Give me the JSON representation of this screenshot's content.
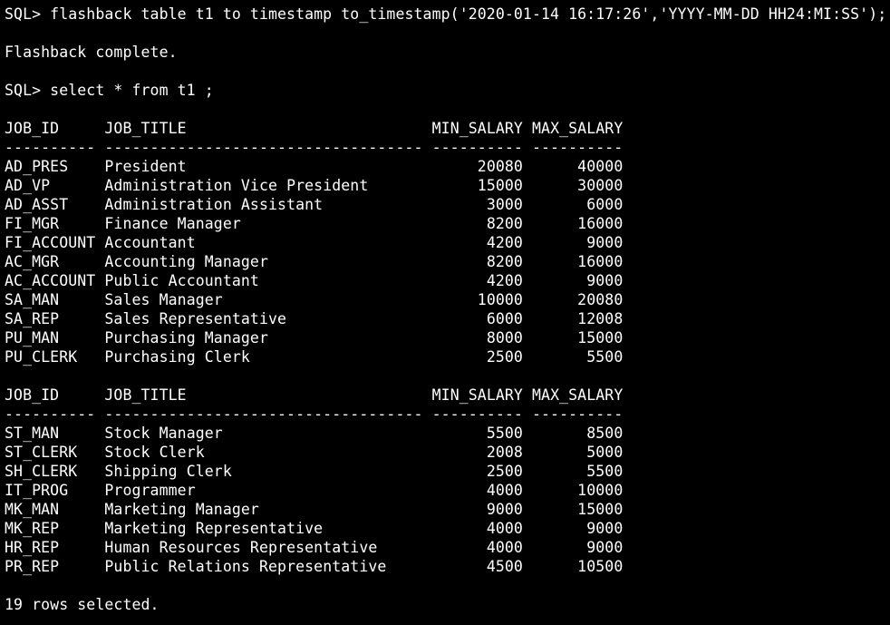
{
  "terminal": {
    "prompt": "SQL> ",
    "command_flashback": "flashback table t1 to timestamp to_timestamp('2020-01-14 16:17:26','YYYY-MM-DD HH24:MI:SS');",
    "flashback_result": "Flashback complete.",
    "command_select": "select * from t1 ;",
    "columns": {
      "job_id": "JOB_ID",
      "job_title": "JOB_TITLE",
      "min_salary": "MIN_SALARY",
      "max_salary": "MAX_SALARY"
    },
    "separator": "---------- ----------------------------------- ---------- ----------",
    "page1_rows": [
      {
        "job_id": "AD_PRES",
        "job_title": "President",
        "min_salary": "20080",
        "max_salary": "40000"
      },
      {
        "job_id": "AD_VP",
        "job_title": "Administration Vice President",
        "min_salary": "15000",
        "max_salary": "30000"
      },
      {
        "job_id": "AD_ASST",
        "job_title": "Administration Assistant",
        "min_salary": "3000",
        "max_salary": "6000"
      },
      {
        "job_id": "FI_MGR",
        "job_title": "Finance Manager",
        "min_salary": "8200",
        "max_salary": "16000"
      },
      {
        "job_id": "FI_ACCOUNT",
        "job_title": "Accountant",
        "min_salary": "4200",
        "max_salary": "9000"
      },
      {
        "job_id": "AC_MGR",
        "job_title": "Accounting Manager",
        "min_salary": "8200",
        "max_salary": "16000"
      },
      {
        "job_id": "AC_ACCOUNT",
        "job_title": "Public Accountant",
        "min_salary": "4200",
        "max_salary": "9000"
      },
      {
        "job_id": "SA_MAN",
        "job_title": "Sales Manager",
        "min_salary": "10000",
        "max_salary": "20080"
      },
      {
        "job_id": "SA_REP",
        "job_title": "Sales Representative",
        "min_salary": "6000",
        "max_salary": "12008"
      },
      {
        "job_id": "PU_MAN",
        "job_title": "Purchasing Manager",
        "min_salary": "8000",
        "max_salary": "15000"
      },
      {
        "job_id": "PU_CLERK",
        "job_title": "Purchasing Clerk",
        "min_salary": "2500",
        "max_salary": "5500"
      }
    ],
    "page2_rows": [
      {
        "job_id": "ST_MAN",
        "job_title": "Stock Manager",
        "min_salary": "5500",
        "max_salary": "8500"
      },
      {
        "job_id": "ST_CLERK",
        "job_title": "Stock Clerk",
        "min_salary": "2008",
        "max_salary": "5000"
      },
      {
        "job_id": "SH_CLERK",
        "job_title": "Shipping Clerk",
        "min_salary": "2500",
        "max_salary": "5500"
      },
      {
        "job_id": "IT_PROG",
        "job_title": "Programmer",
        "min_salary": "4000",
        "max_salary": "10000"
      },
      {
        "job_id": "MK_MAN",
        "job_title": "Marketing Manager",
        "min_salary": "9000",
        "max_salary": "15000"
      },
      {
        "job_id": "MK_REP",
        "job_title": "Marketing Representative",
        "min_salary": "4000",
        "max_salary": "9000"
      },
      {
        "job_id": "HR_REP",
        "job_title": "Human Resources Representative",
        "min_salary": "4000",
        "max_salary": "9000"
      },
      {
        "job_id": "PR_REP",
        "job_title": "Public Relations Representative",
        "min_salary": "4500",
        "max_salary": "10500"
      }
    ],
    "rows_selected": "19 rows selected.",
    "colors": {
      "background": "#000000",
      "foreground": "#ffffff"
    }
  }
}
